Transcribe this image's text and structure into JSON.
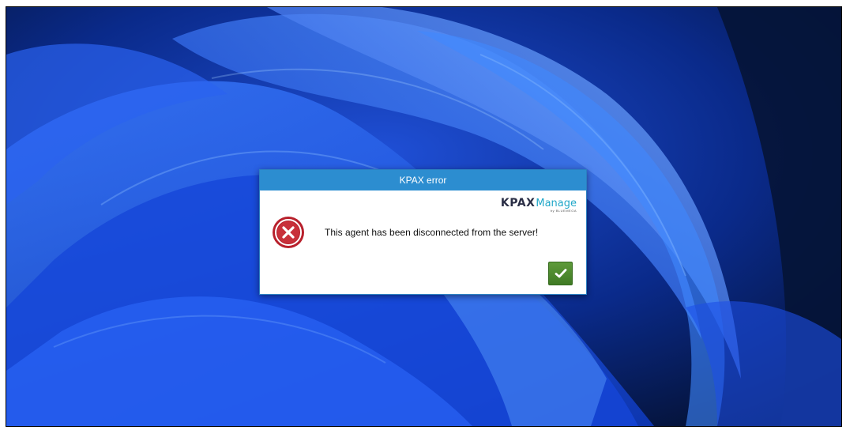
{
  "dialog": {
    "title": "KPAX error",
    "message": "This agent has been disconnected from the server!",
    "icon": "error-circle-x-icon",
    "ok_icon": "checkmark-icon",
    "logo": {
      "primary": "KPAX",
      "secondary": "Manage",
      "byline": "by BLUEMEGA"
    }
  },
  "colors": {
    "titlebar": "#2c8dd0",
    "error_red": "#b8202c",
    "ok_green": "#4d8a2e",
    "logo_dark": "#2a2e45",
    "logo_accent": "#20a7c8"
  }
}
